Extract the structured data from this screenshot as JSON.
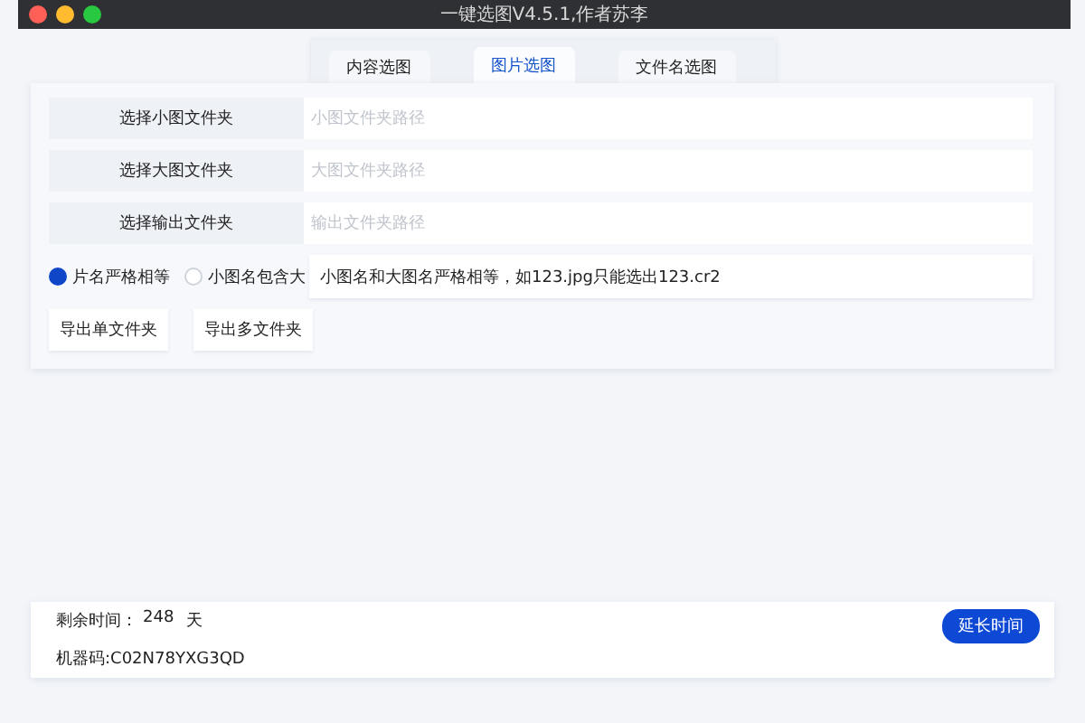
{
  "window": {
    "title": "一键选图V4.5.1,作者苏李"
  },
  "tabs": [
    {
      "label": "内容选图",
      "selected": false
    },
    {
      "label": "图片选图",
      "selected": true
    },
    {
      "label": "文件名选图",
      "selected": false
    }
  ],
  "folder_rows": [
    {
      "button": "选择小图文件夹",
      "placeholder": "小图文件夹路径"
    },
    {
      "button": "选择大图文件夹",
      "placeholder": "大图文件夹路径"
    },
    {
      "button": "选择输出文件夹",
      "placeholder": "输出文件夹路径"
    }
  ],
  "match_options": [
    {
      "label": "片名严格相等",
      "selected": true
    },
    {
      "label": "小图名包含大",
      "selected": false
    }
  ],
  "match_hint": "小图名和大图名严格相等，如123.jpg只能选出123.cr2",
  "export_buttons": [
    "导出单文件夹",
    "导出多文件夹"
  ],
  "footer": {
    "remaining_label": "剩余时间：",
    "remaining_value": "248",
    "remaining_unit": "天",
    "machine_code": "机器码:C02N78YXG3QD",
    "extend_button": "延长时间"
  }
}
